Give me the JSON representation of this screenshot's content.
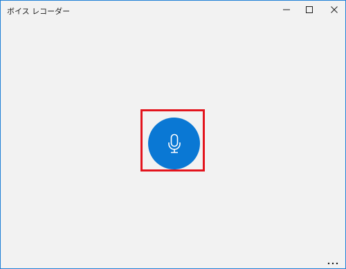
{
  "app": {
    "title": "ボイス レコーダー"
  },
  "titlebar": {
    "minimize_icon": "minimize-icon",
    "maximize_icon": "maximize-icon",
    "close_icon": "close-icon"
  },
  "main": {
    "record_button_icon": "microphone-icon",
    "record_button_color": "#0a78d4",
    "highlight_color": "#e3141d"
  },
  "footer": {
    "more_icon": "more-icon"
  }
}
